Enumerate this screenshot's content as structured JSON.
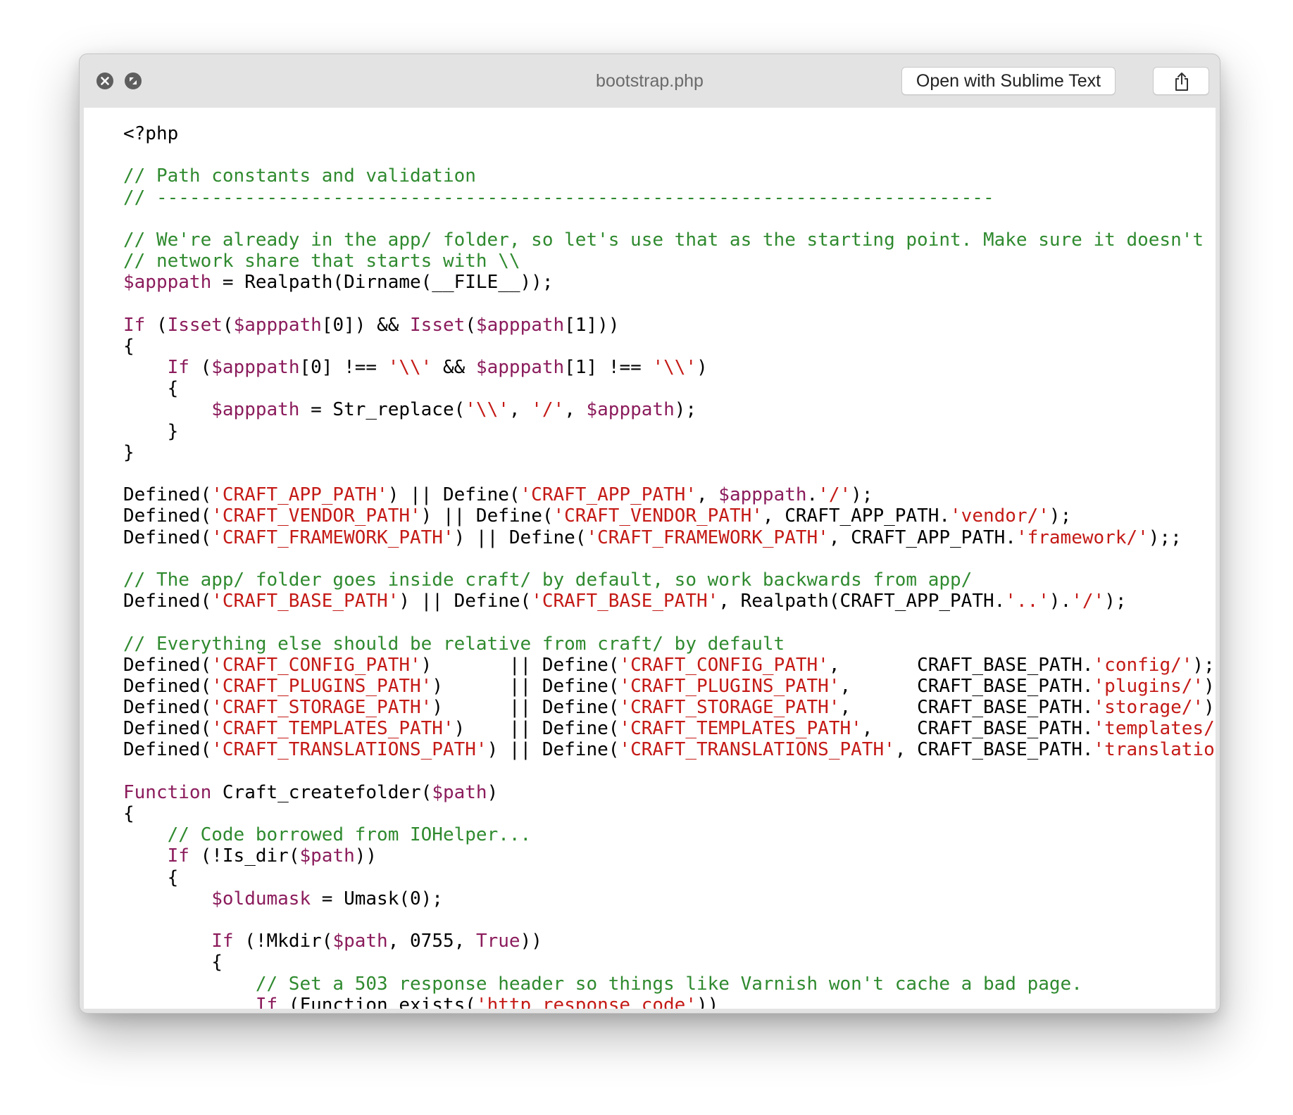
{
  "window": {
    "title": "bootstrap.php",
    "open_button_label": "Open with Sublime Text"
  },
  "icons": {
    "close": "close-icon",
    "fullscreen": "fullscreen-icon",
    "share": "share-icon"
  },
  "colors": {
    "comment": "#2f8a2f",
    "keyword": "#8b1c5c",
    "variable": "#8b1c5c",
    "string": "#c41a16",
    "plain": "#000000"
  },
  "code": {
    "language": "php",
    "lines": [
      [
        [
          "p",
          "<?php"
        ]
      ],
      [],
      [
        [
          "c",
          "// Path constants and validation"
        ]
      ],
      [
        [
          "c",
          "// ----------------------------------------------------------------------------"
        ]
      ],
      [],
      [
        [
          "c",
          "// We're already in the app/ folder, so let's use that as the starting point. Make sure it doesn't"
        ]
      ],
      [
        [
          "c",
          "// network share that starts with \\\\"
        ]
      ],
      [
        [
          "v",
          "$apppath"
        ],
        [
          "p",
          " = Realpath(Dirname(__FILE__));"
        ]
      ],
      [],
      [
        [
          "k",
          "If"
        ],
        [
          "p",
          " ("
        ],
        [
          "k",
          "Isset"
        ],
        [
          "p",
          "("
        ],
        [
          "v",
          "$apppath"
        ],
        [
          "p",
          "[0]) && "
        ],
        [
          "k",
          "Isset"
        ],
        [
          "p",
          "("
        ],
        [
          "v",
          "$apppath"
        ],
        [
          "p",
          "[1]))"
        ]
      ],
      [
        [
          "p",
          "{"
        ]
      ],
      [
        [
          "p",
          "    "
        ],
        [
          "k",
          "If"
        ],
        [
          "p",
          " ("
        ],
        [
          "v",
          "$apppath"
        ],
        [
          "p",
          "[0] !== "
        ],
        [
          "s",
          "'\\\\'"
        ],
        [
          "p",
          " && "
        ],
        [
          "v",
          "$apppath"
        ],
        [
          "p",
          "[1] !== "
        ],
        [
          "s",
          "'\\\\'"
        ],
        [
          "p",
          ")"
        ]
      ],
      [
        [
          "p",
          "    {"
        ]
      ],
      [
        [
          "p",
          "        "
        ],
        [
          "v",
          "$apppath"
        ],
        [
          "p",
          " = Str_replace("
        ],
        [
          "s",
          "'\\\\'"
        ],
        [
          "p",
          ", "
        ],
        [
          "s",
          "'/'"
        ],
        [
          "p",
          ", "
        ],
        [
          "v",
          "$apppath"
        ],
        [
          "p",
          ");"
        ]
      ],
      [
        [
          "p",
          "    }"
        ]
      ],
      [
        [
          "p",
          "}"
        ]
      ],
      [],
      [
        [
          "p",
          "Defined("
        ],
        [
          "s",
          "'CRAFT_APP_PATH'"
        ],
        [
          "p",
          ") || Define("
        ],
        [
          "s",
          "'CRAFT_APP_PATH'"
        ],
        [
          "p",
          ", "
        ],
        [
          "v",
          "$apppath"
        ],
        [
          "p",
          "."
        ],
        [
          "s",
          "'/'"
        ],
        [
          "p",
          ");"
        ]
      ],
      [
        [
          "p",
          "Defined("
        ],
        [
          "s",
          "'CRAFT_VENDOR_PATH'"
        ],
        [
          "p",
          ") || Define("
        ],
        [
          "s",
          "'CRAFT_VENDOR_PATH'"
        ],
        [
          "p",
          ", CRAFT_APP_PATH."
        ],
        [
          "s",
          "'vendor/'"
        ],
        [
          "p",
          ");"
        ]
      ],
      [
        [
          "p",
          "Defined("
        ],
        [
          "s",
          "'CRAFT_FRAMEWORK_PATH'"
        ],
        [
          "p",
          ") || Define("
        ],
        [
          "s",
          "'CRAFT_FRAMEWORK_PATH'"
        ],
        [
          "p",
          ", CRAFT_APP_PATH."
        ],
        [
          "s",
          "'framework/'"
        ],
        [
          "p",
          ");;"
        ]
      ],
      [],
      [
        [
          "c",
          "// The app/ folder goes inside craft/ by default, so work backwards from app/"
        ]
      ],
      [
        [
          "p",
          "Defined("
        ],
        [
          "s",
          "'CRAFT_BASE_PATH'"
        ],
        [
          "p",
          ") || Define("
        ],
        [
          "s",
          "'CRAFT_BASE_PATH'"
        ],
        [
          "p",
          ", Realpath(CRAFT_APP_PATH."
        ],
        [
          "s",
          "'..'"
        ],
        [
          "p",
          ")."
        ],
        [
          "s",
          "'/'"
        ],
        [
          "p",
          ");"
        ]
      ],
      [],
      [
        [
          "c",
          "// Everything else should be relative from craft/ by default"
        ]
      ],
      [
        [
          "p",
          "Defined("
        ],
        [
          "s",
          "'CRAFT_CONFIG_PATH'"
        ],
        [
          "p",
          ")       || Define("
        ],
        [
          "s",
          "'CRAFT_CONFIG_PATH'"
        ],
        [
          "p",
          ",       CRAFT_BASE_PATH."
        ],
        [
          "s",
          "'config/'"
        ],
        [
          "p",
          ");"
        ]
      ],
      [
        [
          "p",
          "Defined("
        ],
        [
          "s",
          "'CRAFT_PLUGINS_PATH'"
        ],
        [
          "p",
          ")      || Define("
        ],
        [
          "s",
          "'CRAFT_PLUGINS_PATH'"
        ],
        [
          "p",
          ",      CRAFT_BASE_PATH."
        ],
        [
          "s",
          "'plugins/'"
        ],
        [
          "p",
          ");"
        ]
      ],
      [
        [
          "p",
          "Defined("
        ],
        [
          "s",
          "'CRAFT_STORAGE_PATH'"
        ],
        [
          "p",
          ")      || Define("
        ],
        [
          "s",
          "'CRAFT_STORAGE_PATH'"
        ],
        [
          "p",
          ",      CRAFT_BASE_PATH."
        ],
        [
          "s",
          "'storage/'"
        ],
        [
          "p",
          ");"
        ]
      ],
      [
        [
          "p",
          "Defined("
        ],
        [
          "s",
          "'CRAFT_TEMPLATES_PATH'"
        ],
        [
          "p",
          ")    || Define("
        ],
        [
          "s",
          "'CRAFT_TEMPLATES_PATH'"
        ],
        [
          "p",
          ",    CRAFT_BASE_PATH."
        ],
        [
          "s",
          "'templates/'"
        ],
        [
          "p",
          ");"
        ]
      ],
      [
        [
          "p",
          "Defined("
        ],
        [
          "s",
          "'CRAFT_TRANSLATIONS_PATH'"
        ],
        [
          "p",
          ") || Define("
        ],
        [
          "s",
          "'CRAFT_TRANSLATIONS_PATH'"
        ],
        [
          "p",
          ", CRAFT_BASE_PATH."
        ],
        [
          "s",
          "'translations/'"
        ],
        [
          "p",
          ");"
        ]
      ],
      [],
      [
        [
          "k",
          "Function"
        ],
        [
          "p",
          " Craft_createfolder("
        ],
        [
          "v",
          "$path"
        ],
        [
          "p",
          ")"
        ]
      ],
      [
        [
          "p",
          "{"
        ]
      ],
      [
        [
          "p",
          "    "
        ],
        [
          "c",
          "// Code borrowed from IOHelper..."
        ]
      ],
      [
        [
          "p",
          "    "
        ],
        [
          "k",
          "If"
        ],
        [
          "p",
          " (!Is_dir("
        ],
        [
          "v",
          "$path"
        ],
        [
          "p",
          "))"
        ]
      ],
      [
        [
          "p",
          "    {"
        ]
      ],
      [
        [
          "p",
          "        "
        ],
        [
          "v",
          "$oldumask"
        ],
        [
          "p",
          " = Umask(0);"
        ]
      ],
      [],
      [
        [
          "p",
          "        "
        ],
        [
          "k",
          "If"
        ],
        [
          "p",
          " (!Mkdir("
        ],
        [
          "v",
          "$path"
        ],
        [
          "p",
          ", 0755, "
        ],
        [
          "k",
          "True"
        ],
        [
          "p",
          "))"
        ]
      ],
      [
        [
          "p",
          "        {"
        ]
      ],
      [
        [
          "p",
          "            "
        ],
        [
          "c",
          "// Set a 503 response header so things like Varnish won't cache a bad page."
        ]
      ],
      [
        [
          "p",
          "            "
        ],
        [
          "k",
          "If"
        ],
        [
          "p",
          " (Function_exists("
        ],
        [
          "s",
          "'http_response_code'"
        ],
        [
          "p",
          "))"
        ]
      ]
    ]
  }
}
